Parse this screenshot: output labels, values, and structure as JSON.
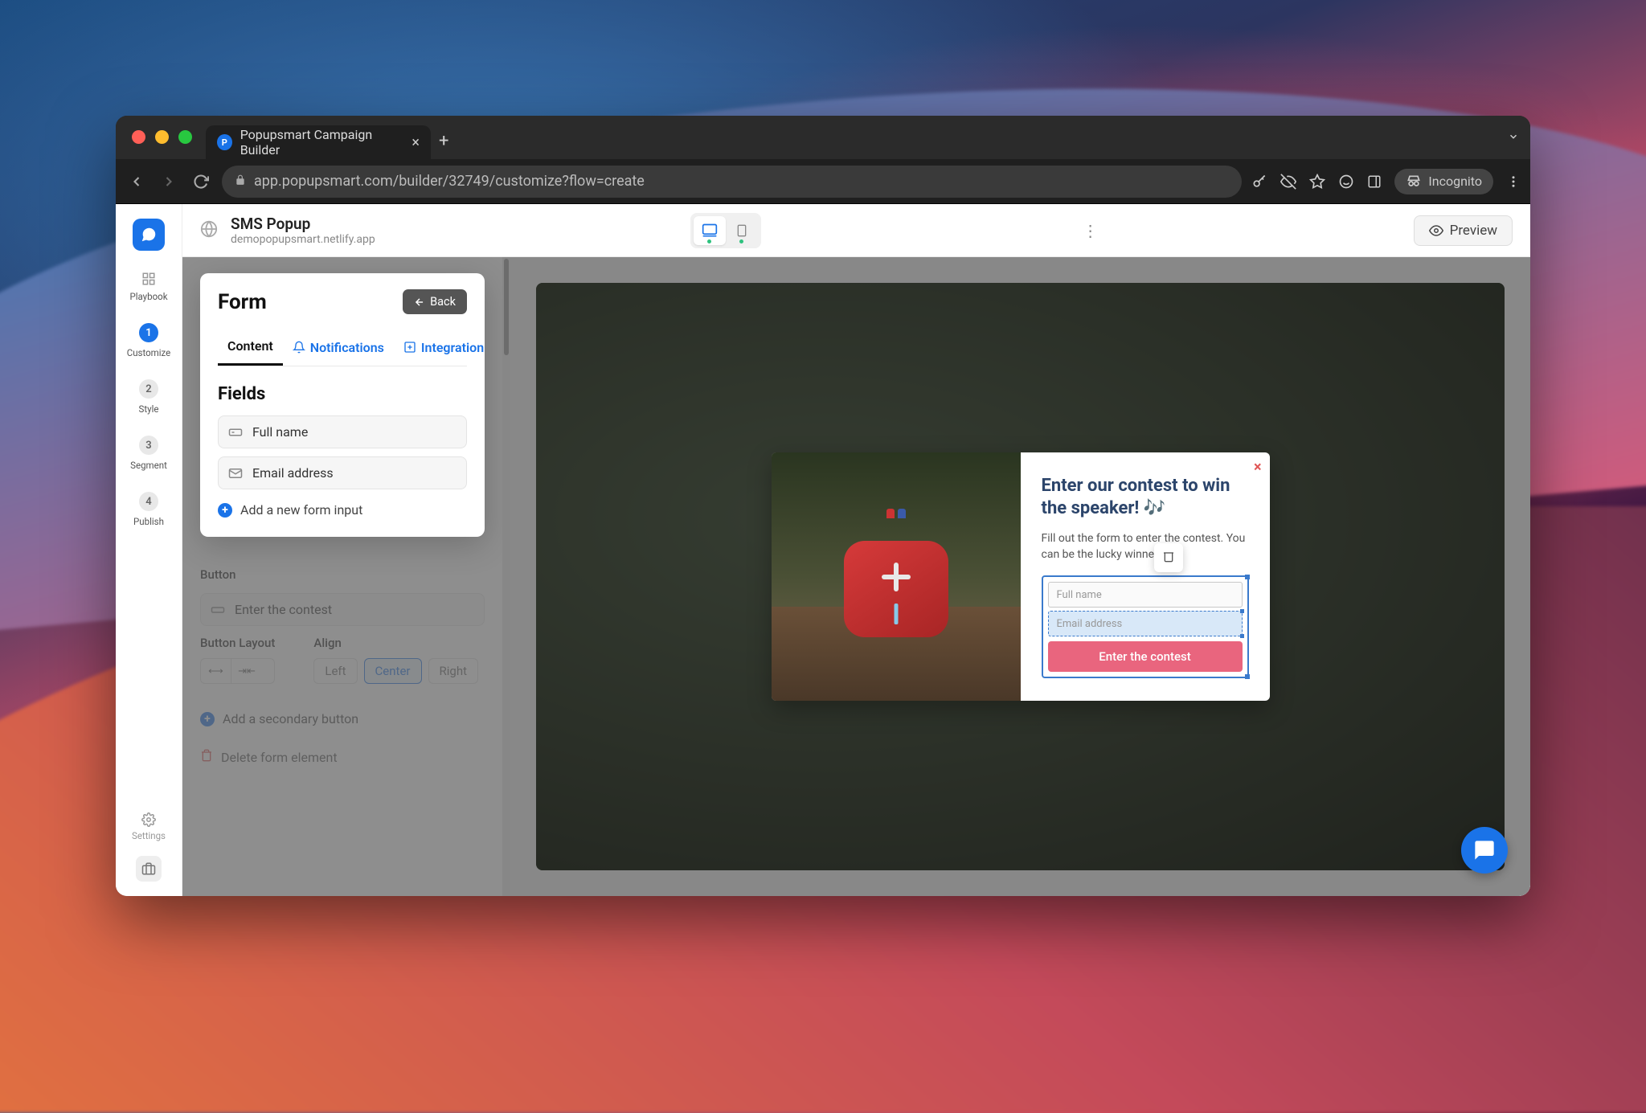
{
  "browser": {
    "tab_title": "Popupsmart Campaign Builder",
    "url": "app.popupsmart.com/builder/32749/customize?flow=create",
    "incognito_label": "Incognito"
  },
  "sidebar": {
    "steps": [
      {
        "num": "",
        "label": "Playbook",
        "icon": "grid"
      },
      {
        "num": "1",
        "label": "Customize",
        "active": true
      },
      {
        "num": "2",
        "label": "Style"
      },
      {
        "num": "3",
        "label": "Segment"
      },
      {
        "num": "4",
        "label": "Publish"
      }
    ],
    "settings_label": "Settings"
  },
  "topbar": {
    "title": "SMS Popup",
    "subtitle": "demopopupsmart.netlify.app",
    "preview_label": "Preview"
  },
  "panel": {
    "title": "Form",
    "back_label": "Back",
    "tabs": [
      {
        "label": "Content"
      },
      {
        "label": "Notifications"
      },
      {
        "label": "Integration"
      }
    ],
    "fields_title": "Fields",
    "fields": [
      {
        "label": "Full name",
        "icon": "text-field"
      },
      {
        "label": "Email address",
        "icon": "mail"
      }
    ],
    "add_input_label": "Add a new form input",
    "button_label": "Button",
    "button_value": "Enter the contest",
    "layout_label": "Button Layout",
    "align_label": "Align",
    "align_options": {
      "left": "Left",
      "center": "Center",
      "right": "Right"
    },
    "add_secondary_label": "Add a secondary button",
    "delete_label": "Delete form element"
  },
  "popup": {
    "title": "Enter our contest to win the speaker! 🎶",
    "desc": "Fill out the form to enter the contest. You can be the lucky winner! 😊",
    "input_full_name": "Full name",
    "input_email": "Email address",
    "submit_label": "Enter the contest"
  }
}
